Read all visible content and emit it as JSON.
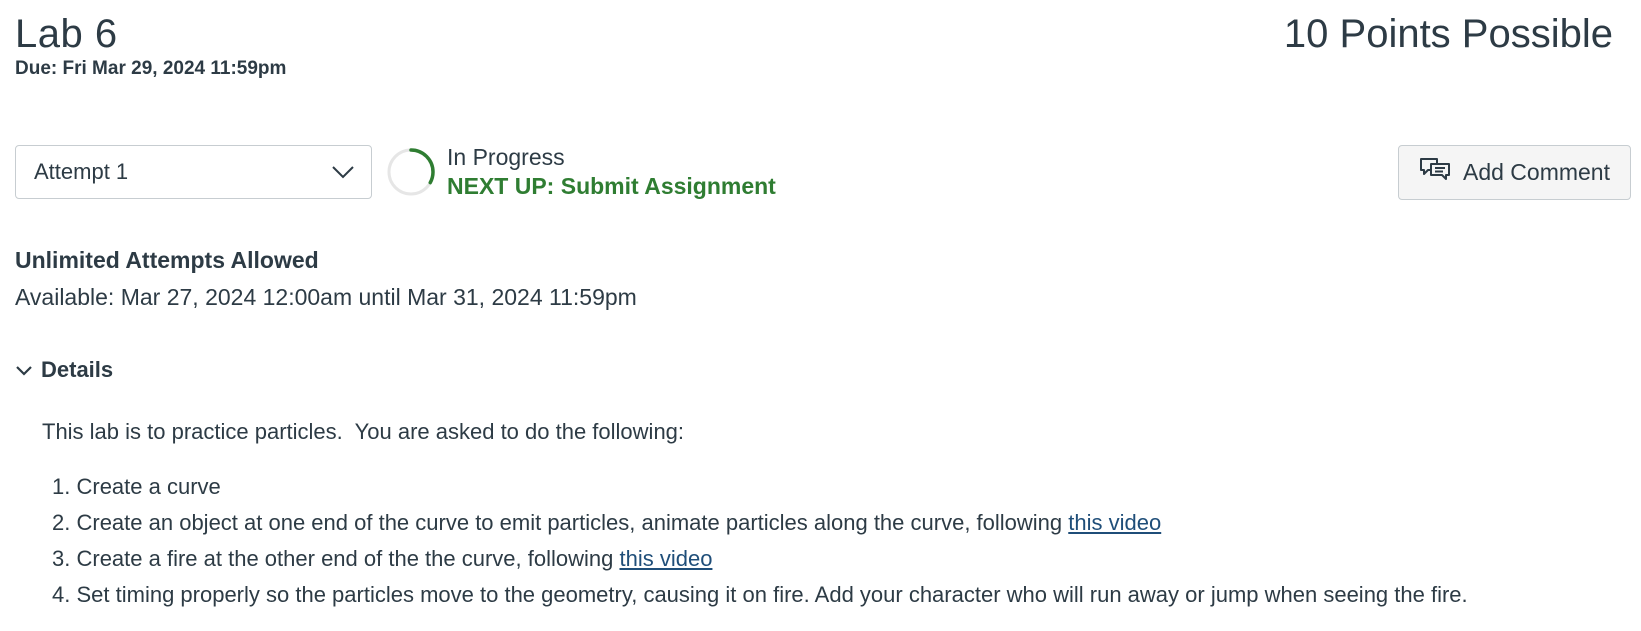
{
  "assignment": {
    "title": "Lab 6",
    "due": "Due: Fri Mar 29, 2024 11:59pm",
    "points": "10 Points Possible"
  },
  "attempt": {
    "selected": "Attempt 1",
    "status": "In Progress",
    "next_up": "NEXT UP: Submit Assignment",
    "progress_fraction": 0.33,
    "progress_color": "#2f7d32"
  },
  "comment": {
    "label": "Add Comment"
  },
  "availability": {
    "attempts_allowed": "Unlimited Attempts Allowed",
    "available": "Available: Mar 27, 2024 12:00am until Mar 31, 2024 11:59pm"
  },
  "details": {
    "label": "Details",
    "intro": "This lab is to practice particles.  You are asked to do the following:",
    "steps": [
      {
        "number": "1.",
        "text": "Create a curve",
        "link": ""
      },
      {
        "number": "2.",
        "text": "Create an object at one end of the curve to emit particles, animate particles along the curve, following ",
        "link": "this video"
      },
      {
        "number": "3.",
        "text": "Create a fire at the other end of the the curve, following ",
        "link": "this video"
      },
      {
        "number": "4.",
        "text": "Set timing properly so the particles move to the geometry, causing it on fire. Add your character who will run away or jump when seeing the fire.",
        "link": ""
      }
    ]
  },
  "icons": {
    "dropdown": "chevron-down-icon",
    "progress": "progress-ring-icon",
    "comment": "comment-icon",
    "details_toggle": "chevron-down-icon"
  }
}
